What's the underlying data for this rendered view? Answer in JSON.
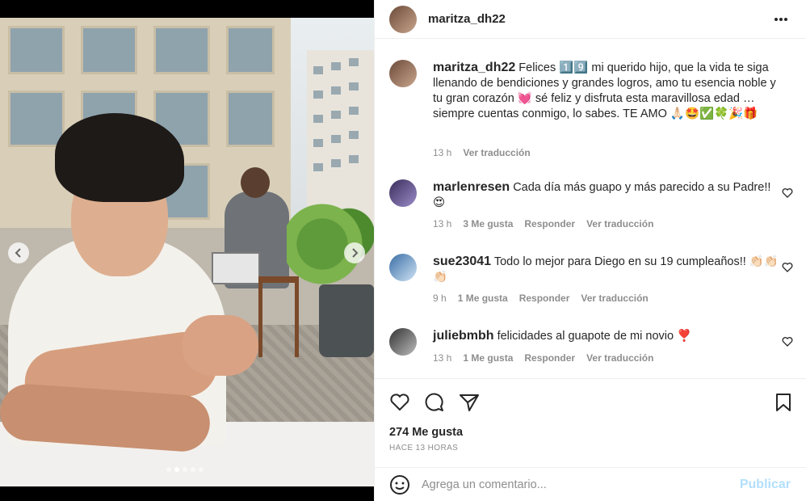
{
  "post": {
    "username": "maritza_dh22",
    "caption": {
      "username": "maritza_dh22",
      "text_1": "Felices",
      "emoji_1": "1️⃣9️⃣",
      "text_2": "mi querido hijo, que la vida te siga llenando de bendiciones y grandes logros, amo tu esencia noble y tu gran corazón",
      "emoji_2": "💓",
      "text_3": "sé feliz y disfruta esta maravillosa edad … siempre cuentas conmigo, lo sabes. TE AMO",
      "emoji_3": "🙏🏻🤩✅🍀🎉🎁",
      "time": "13 h",
      "translate": "Ver traducción"
    },
    "comments": [
      {
        "username": "marlenresen",
        "text": "Cada día más guapo y más parecido a su Padre!!",
        "emoji": "😍",
        "time": "13 h",
        "likes": "3 Me gusta",
        "reply": "Responder",
        "translate": "Ver traducción"
      },
      {
        "username": "sue23041",
        "text": "Todo lo mejor para Diego en su 19 cumpleaños!!",
        "emoji": "👏🏻👏🏻👏🏻",
        "time": "9 h",
        "likes": "1 Me gusta",
        "reply": "Responder",
        "translate": "Ver traducción"
      },
      {
        "username": "juliebmbh",
        "text": "felicidades al guapote de mi novio",
        "emoji": "❣️",
        "time": "13 h",
        "likes": "1 Me gusta",
        "reply": "Responder",
        "translate": "Ver traducción"
      }
    ],
    "like_count": "274 Me gusta",
    "posted_ago": "HACE 13 HORAS",
    "composer": {
      "placeholder": "Agrega un comentario...",
      "post_label": "Publicar"
    },
    "carousel": {
      "slides": 5,
      "active_index": 1
    }
  },
  "colors": {
    "link_disabled": "#b2dffc",
    "muted": "#8e8e8e",
    "text": "#262626"
  }
}
